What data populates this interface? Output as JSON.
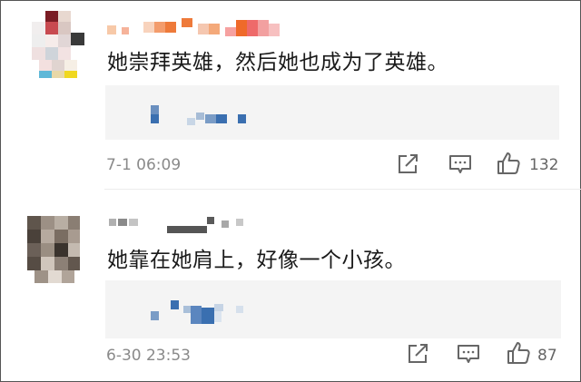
{
  "comments": [
    {
      "text": "她崇拜英雄，然后她也成为了英雄。",
      "time": "7-1 06:09",
      "likes": "132",
      "icons": [
        "share-icon",
        "comment-icon",
        "like-icon"
      ]
    },
    {
      "text": "她靠在她肩上，好像一个小孩。",
      "time": "6-30 23:53",
      "likes": "87",
      "icons": [
        "share-icon",
        "comment-icon",
        "like-icon"
      ]
    }
  ],
  "colors": {
    "text": "#1a1a1a",
    "meta": "#8a8a8a",
    "quote_bg": "#f4f4f4",
    "mosaic_blue": "#3a6fb0"
  }
}
